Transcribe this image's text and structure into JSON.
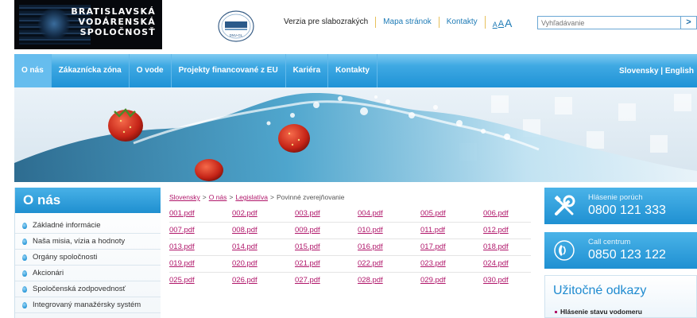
{
  "header": {
    "logo_lines": [
      "BRATISLAVSKÁ",
      "VODÁRENSKÁ",
      "SPOLOČNOSŤ"
    ],
    "cert_label": "DNV-GL",
    "links": [
      "Verzia pre slabozrakých",
      "Mapa stránok",
      "Kontakty"
    ],
    "font_sizes": [
      "A",
      "A",
      "A"
    ],
    "search_placeholder": "Vyhľadávanie",
    "search_button": ">"
  },
  "nav": {
    "items": [
      "O nás",
      "Zákaznícka zóna",
      "O vode",
      "Projekty financované z EU",
      "Kariéra",
      "Kontakty"
    ],
    "active": "O nás",
    "languages": "Slovensky | English"
  },
  "sidebar": {
    "title": "O nás",
    "items": [
      "Základné informácie",
      "Naša misia, vízia a hodnoty",
      "Orgány spoločnosti",
      "Akcionári",
      "Spoločenská zodpovednosť",
      "Integrovaný manažérsky systém"
    ]
  },
  "breadcrumb": {
    "items": [
      "Slovensky",
      "O nás",
      "Legislatíva"
    ],
    "current": "Povinné zverejňovanie",
    "separator": ">"
  },
  "pdfs": [
    "001.pdf",
    "002.pdf",
    "003.pdf",
    "004.pdf",
    "005.pdf",
    "006.pdf",
    "007.pdf",
    "008.pdf",
    "009.pdf",
    "010.pdf",
    "011.pdf",
    "012.pdf",
    "013.pdf",
    "014.pdf",
    "015.pdf",
    "016.pdf",
    "017.pdf",
    "018.pdf",
    "019.pdf",
    "020.pdf",
    "021.pdf",
    "022.pdf",
    "023.pdf",
    "024.pdf",
    "025.pdf",
    "026.pdf",
    "027.pdf",
    "028.pdf",
    "029.pdf",
    "030.pdf"
  ],
  "right_panel": {
    "boxes": [
      {
        "label": "Hlásenie porúch",
        "phone": "0800 121 333",
        "icon": "tools-icon"
      },
      {
        "label": "Call centrum",
        "phone": "0850 123 122",
        "icon": "phone-icon"
      }
    ],
    "useful_title": "Užitočné odkazy",
    "useful_items": [
      "Hlásenie stavu vodomeru"
    ]
  },
  "colors": {
    "nav_blue": "#1f92d6",
    "link_magenta": "#b0166a",
    "accent_blue": "#1e7bb6",
    "divider_gold": "#e7c05b"
  }
}
